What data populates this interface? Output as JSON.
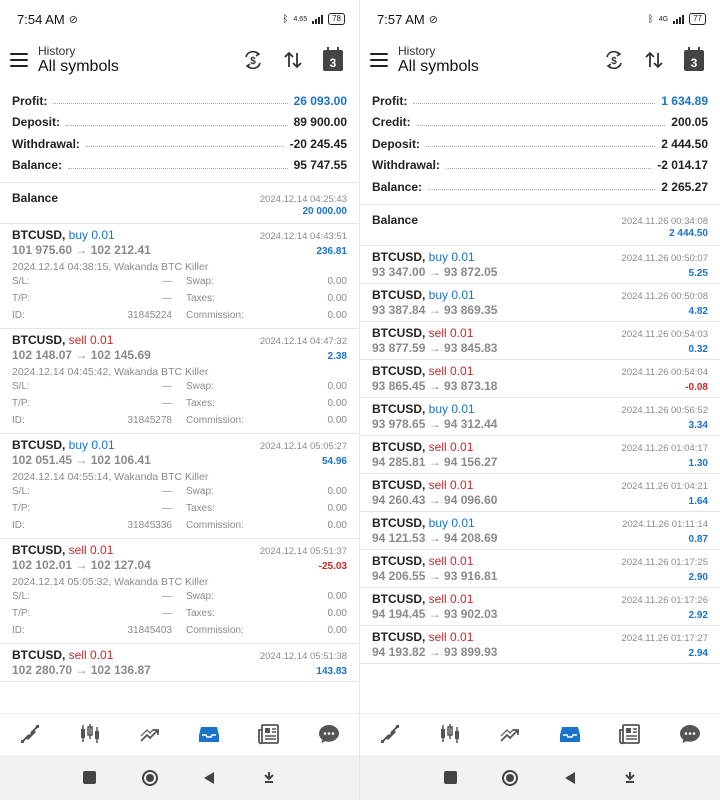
{
  "left": {
    "status": {
      "time": "7:54 AM",
      "network": "4.65",
      "battery": "78"
    },
    "toolbar": {
      "subtitle": "History",
      "title": "All symbols",
      "calendar_day": "3"
    },
    "summary": [
      {
        "label": "Profit:",
        "value": "26 093.00",
        "highlight": true
      },
      {
        "label": "Deposit:",
        "value": "89 900.00",
        "highlight": false
      },
      {
        "label": "Withdrawal:",
        "value": "-20 245.45",
        "highlight": false
      },
      {
        "label": "Balance:",
        "value": "95 747.55",
        "highlight": false
      }
    ],
    "balance_entry": {
      "title": "Balance",
      "datetime": "2024.12.14 04:25:43",
      "amount": "20 000.00"
    },
    "detail_labels": {
      "sl": "S/L:",
      "tp": "T/P:",
      "id": "ID:",
      "swap": "Swap:",
      "taxes": "Taxes:",
      "commission": "Commission:"
    },
    "trades": [
      {
        "symbol": "BTCUSD,",
        "side": "buy 0.01",
        "side_type": "buy",
        "datetime": "2024.12.14 04:43:51",
        "prices": "101 975.60 → 102 212.41",
        "profit": "236.81",
        "negative": false,
        "comment": "2024.12.14 04:38:15, Wakanda BTC Killer",
        "sl": "—",
        "tp": "—",
        "id": "31845224",
        "swap": "0.00",
        "taxes": "0.00",
        "commission": "0.00"
      },
      {
        "symbol": "BTCUSD,",
        "side": "sell 0.01",
        "side_type": "sell",
        "datetime": "2024.12.14 04:47:32",
        "prices": "102 148.07 → 102 145.69",
        "profit": "2.38",
        "negative": false,
        "comment": "2024.12.14 04:45:42, Wakanda BTC Killer",
        "sl": "—",
        "tp": "—",
        "id": "31845278",
        "swap": "0.00",
        "taxes": "0.00",
        "commission": "0.00"
      },
      {
        "symbol": "BTCUSD,",
        "side": "buy 0.01",
        "side_type": "buy",
        "datetime": "2024.12.14 05:05:27",
        "prices": "102 051.45 → 102 106.41",
        "profit": "54.96",
        "negative": false,
        "comment": "2024.12.14 04:55:14, Wakanda BTC Killer",
        "sl": "—",
        "tp": "—",
        "id": "31845336",
        "swap": "0.00",
        "taxes": "0.00",
        "commission": "0.00"
      },
      {
        "symbol": "BTCUSD,",
        "side": "sell 0.01",
        "side_type": "sell",
        "datetime": "2024.12.14 05:51:37",
        "prices": "102 102.01 → 102 127.04",
        "profit": "-25.03",
        "negative": true,
        "comment": "2024.12.14 05:05:32, Wakanda BTC Killer",
        "sl": "—",
        "tp": "—",
        "id": "31845403",
        "swap": "0.00",
        "taxes": "0.00",
        "commission": "0.00"
      },
      {
        "symbol": "BTCUSD,",
        "side": "sell 0.01",
        "side_type": "sell",
        "datetime": "2024.12.14 05:51:38",
        "prices": "102 280.70 → 102 136.87",
        "profit": "143.83",
        "negative": false
      }
    ]
  },
  "right": {
    "status": {
      "time": "7:57 AM",
      "network": "4G",
      "battery": "77"
    },
    "toolbar": {
      "subtitle": "History",
      "title": "All symbols",
      "calendar_day": "3"
    },
    "summary": [
      {
        "label": "Profit:",
        "value": "1 634.89",
        "highlight": true
      },
      {
        "label": "Credit:",
        "value": "200.05",
        "highlight": false
      },
      {
        "label": "Deposit:",
        "value": "2 444.50",
        "highlight": false
      },
      {
        "label": "Withdrawal:",
        "value": "-2 014.17",
        "highlight": false
      },
      {
        "label": "Balance:",
        "value": "2 265.27",
        "highlight": false
      }
    ],
    "balance_entry": {
      "title": "Balance",
      "datetime": "2024.11.26 00:34:08",
      "amount": "2 444.50"
    },
    "trades": [
      {
        "symbol": "BTCUSD,",
        "side": "buy 0.01",
        "side_type": "buy",
        "datetime": "2024.11.26 00:50:07",
        "prices": "93 347.00 → 93 872.05",
        "profit": "5.25",
        "negative": false
      },
      {
        "symbol": "BTCUSD,",
        "side": "buy 0.01",
        "side_type": "buy",
        "datetime": "2024.11.26 00:50:08",
        "prices": "93 387.84 → 93 869.35",
        "profit": "4.82",
        "negative": false
      },
      {
        "symbol": "BTCUSD,",
        "side": "sell 0.01",
        "side_type": "sell",
        "datetime": "2024.11.26 00:54:03",
        "prices": "93 877.59 → 93 845.83",
        "profit": "0.32",
        "negative": false
      },
      {
        "symbol": "BTCUSD,",
        "side": "sell 0.01",
        "side_type": "sell",
        "datetime": "2024.11.26 00:54:04",
        "prices": "93 865.45 → 93 873.18",
        "profit": "-0.08",
        "negative": true
      },
      {
        "symbol": "BTCUSD,",
        "side": "buy 0.01",
        "side_type": "buy",
        "datetime": "2024.11.26 00:56:52",
        "prices": "93 978.65 → 94 312.44",
        "profit": "3.34",
        "negative": false
      },
      {
        "symbol": "BTCUSD,",
        "side": "sell 0.01",
        "side_type": "sell",
        "datetime": "2024.11.26 01:04:17",
        "prices": "94 285.81 → 94 156.27",
        "profit": "1.30",
        "negative": false
      },
      {
        "symbol": "BTCUSD,",
        "side": "sell 0.01",
        "side_type": "sell",
        "datetime": "2024.11.26 01:04:21",
        "prices": "94 260.43 → 94 096.60",
        "profit": "1.64",
        "negative": false
      },
      {
        "symbol": "BTCUSD,",
        "side": "buy 0.01",
        "side_type": "buy",
        "datetime": "2024.11.26 01:11:14",
        "prices": "94 121.53 → 94 208.69",
        "profit": "0.87",
        "negative": false
      },
      {
        "symbol": "BTCUSD,",
        "side": "sell 0.01",
        "side_type": "sell",
        "datetime": "2024.11.26 01:17:25",
        "prices": "94 206.55 → 93 916.81",
        "profit": "2.90",
        "negative": false
      },
      {
        "symbol": "BTCUSD,",
        "side": "sell 0.01",
        "side_type": "sell",
        "datetime": "2024.11.26 01:17:26",
        "prices": "94 194.45 → 93 902.03",
        "profit": "2.92",
        "negative": false
      },
      {
        "symbol": "BTCUSD,",
        "side": "sell 0.01",
        "side_type": "sell",
        "datetime": "2024.11.26 01:17:27",
        "prices": "94 193.82 → 93 899.93",
        "profit": "2.94",
        "negative": false
      }
    ]
  },
  "bottom_nav": [
    {
      "name": "quotes-icon",
      "active": false
    },
    {
      "name": "chart-candles-icon",
      "active": false
    },
    {
      "name": "trade-icon",
      "active": false
    },
    {
      "name": "history-inbox-icon",
      "active": true
    },
    {
      "name": "news-icon",
      "active": false
    },
    {
      "name": "messages-icon",
      "active": false
    }
  ],
  "colors": {
    "accent": "#1a73c9",
    "sell": "#c62828",
    "inactive_icon": "#555555"
  }
}
